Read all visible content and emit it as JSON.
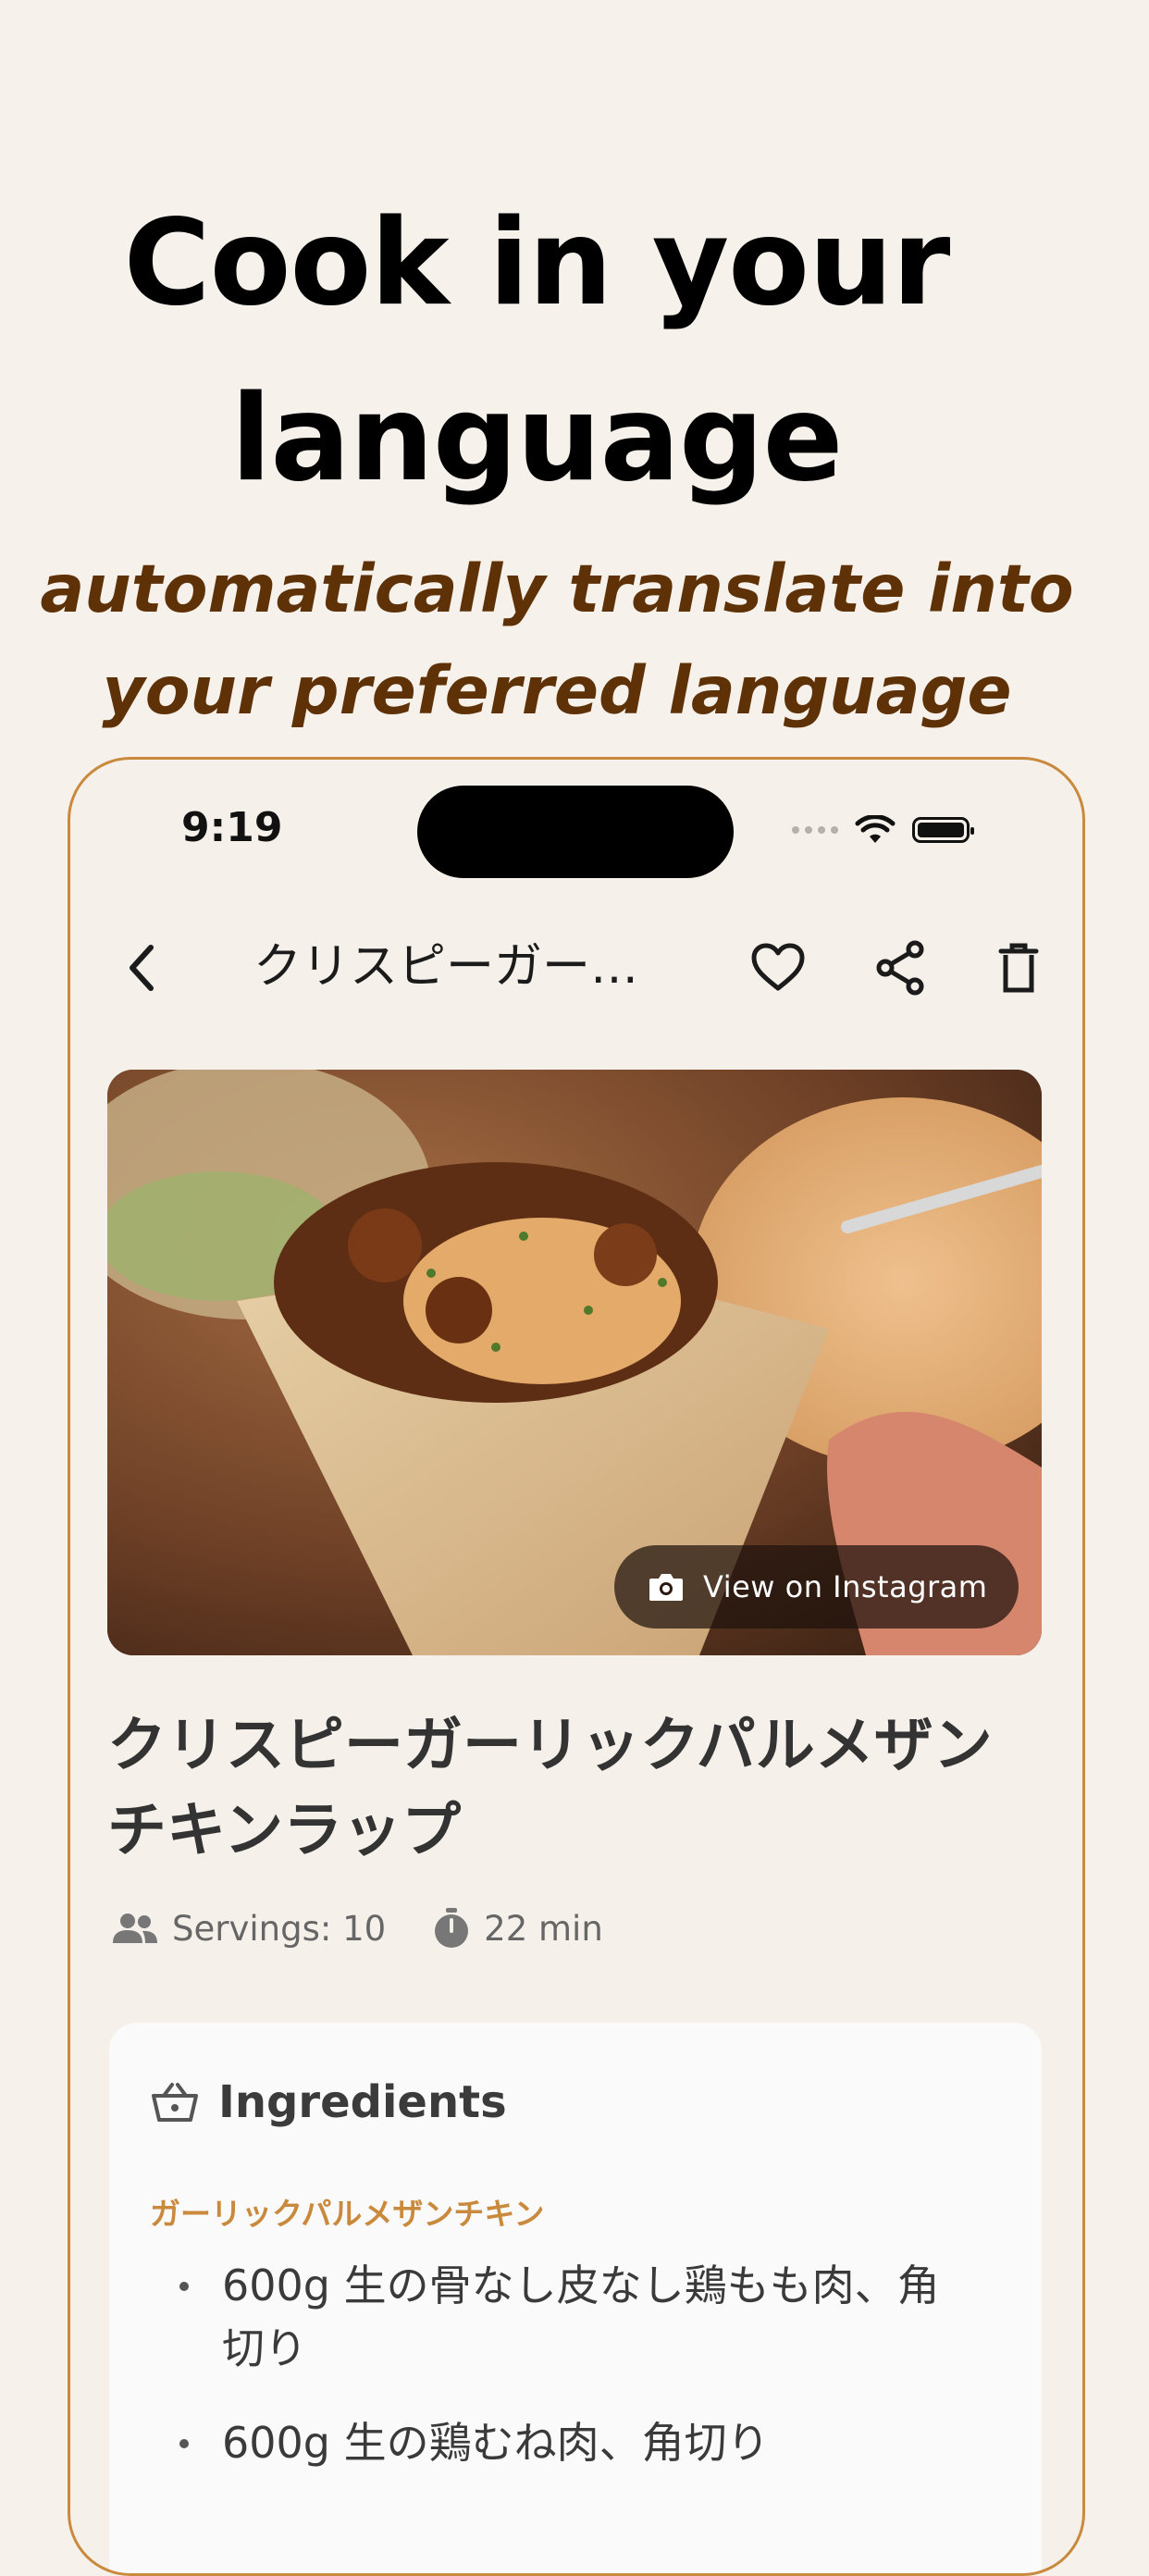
{
  "promo": {
    "headline_line1": "Cook in your",
    "headline_line2": "language",
    "subline_line1": "automatically translate into",
    "subline_line2": "your preferred language"
  },
  "status_bar": {
    "time": "9:19"
  },
  "nav": {
    "title": "クリスピーガー…",
    "icons": [
      "back-chevron-icon",
      "heart-icon",
      "share-icon",
      "trash-icon"
    ]
  },
  "hero": {
    "instagram_label": "View on Instagram",
    "icon": "camera-icon"
  },
  "recipe": {
    "title_line1": "クリスピーガーリックパルメザン",
    "title_line2": "チキンラップ",
    "servings": "Servings: 10",
    "time": "22 min"
  },
  "ingredients": {
    "heading": "Ingredients",
    "section": "ガーリックパルメザンチキン",
    "items": [
      {
        "line1": "600g 生の骨なし皮なし鶏もも肉、角",
        "line2": "切り"
      },
      {
        "line1": "600g 生の鶏むね肉、角切り",
        "line2": ""
      }
    ]
  },
  "colors": {
    "background": "#f6f1ea",
    "accent": "#c98a3e",
    "subline": "#5e3107"
  }
}
